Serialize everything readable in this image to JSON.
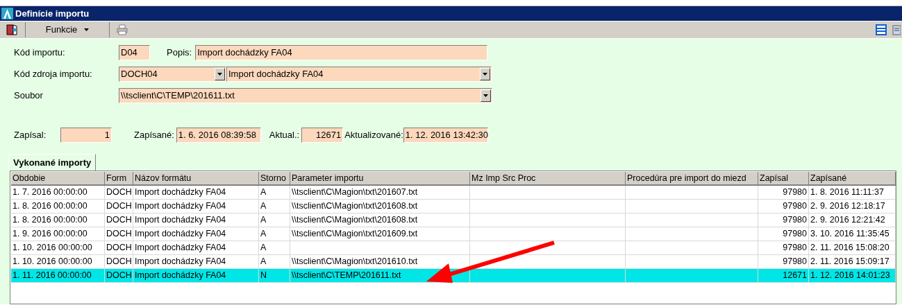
{
  "window": {
    "title": "Definície importu"
  },
  "toolbar": {
    "menu": "Funkcie"
  },
  "form": {
    "kod_importu": {
      "label": "Kód importu:",
      "value": "D04"
    },
    "popis": {
      "label": "Popis:",
      "value": "Import dochádzky FA04"
    },
    "kod_zdroja": {
      "label": "Kód zdroja importu:",
      "value": "DOCH04",
      "description": "Import dochádzky FA04"
    },
    "soubor": {
      "label": "Soubor",
      "value": "\\\\tsclient\\C\\TEMP\\201611.txt"
    },
    "zapisal": {
      "label": "Zapísal:",
      "value": "1"
    },
    "zapisane": {
      "label": "Zapísané:",
      "value": "1. 6. 2016 08:39:58"
    },
    "aktual": {
      "label": "Aktual.:",
      "value": "12671"
    },
    "aktualizovane": {
      "label": "Aktualizované:",
      "value": "1. 12. 2016 13:42:30"
    }
  },
  "tabs": [
    {
      "label": "Vykonané importy",
      "selected": true
    }
  ],
  "table": {
    "columns": [
      "Obdobie",
      "Form",
      "Názov formátu",
      "Storno",
      "Parameter importu",
      "Mz Imp Src Proc",
      "Procedúra pre import do miezd",
      "Zapísal",
      "Zapísané"
    ],
    "rows": [
      {
        "obdobie": "1. 7. 2016 00:00:00",
        "form": "DOCH",
        "nazov": "Import dochádzky FA04",
        "storno": "A",
        "parameter": "\\\\tsclient\\C\\Magion\\txt\\201607.txt",
        "zapisal": "97980",
        "zapisane": "1. 8. 2016 11:11:37",
        "selected": false
      },
      {
        "obdobie": "1. 8. 2016 00:00:00",
        "form": "DOCH",
        "nazov": "Import dochádzky FA04",
        "storno": "A",
        "parameter": "\\\\tsclient\\C\\Magion\\txt\\201608.txt",
        "zapisal": "97980",
        "zapisane": "2. 9. 2016 12:18:17",
        "selected": false
      },
      {
        "obdobie": "1. 8. 2016 00:00:00",
        "form": "DOCH",
        "nazov": "Import dochádzky FA04",
        "storno": "A",
        "parameter": "\\\\tsclient\\C\\Magion\\txt\\201608.txt",
        "zapisal": "97980",
        "zapisane": "2. 9. 2016 12:21:42",
        "selected": false
      },
      {
        "obdobie": "1. 9. 2016 00:00:00",
        "form": "DOCH",
        "nazov": "Import dochádzky FA04",
        "storno": "A",
        "parameter": "\\\\tsclient\\C\\Magion\\txt\\201609.txt",
        "zapisal": "97980",
        "zapisane": "3. 10. 2016 11:35:45",
        "selected": false
      },
      {
        "obdobie": "1. 10. 2016 00:00:00",
        "form": "DOCH",
        "nazov": "Import dochádzky FA04",
        "storno": "A",
        "zapisal": "97980",
        "zapisane": "2. 11. 2016 15:08:20",
        "selected": false
      },
      {
        "obdobie": "1. 10. 2016 00:00:00",
        "form": "DOCH",
        "nazov": "Import dochádzky FA04",
        "storno": "A",
        "parameter": "\\\\tsclient\\C\\Magion\\txt\\201610.txt",
        "zapisal": "97980",
        "zapisane": "2. 11. 2016 15:09:17",
        "selected": false
      },
      {
        "obdobie": "1. 11. 2016 00:00:00",
        "form": "DOCH",
        "nazov": "Import dochádzky FA04",
        "storno": "N",
        "parameter": "\\\\tsclient\\C\\TEMP\\201611.txt",
        "zapisal": "12671",
        "zapisane": "1. 12. 2016 14:01:23",
        "selected": true
      }
    ]
  }
}
